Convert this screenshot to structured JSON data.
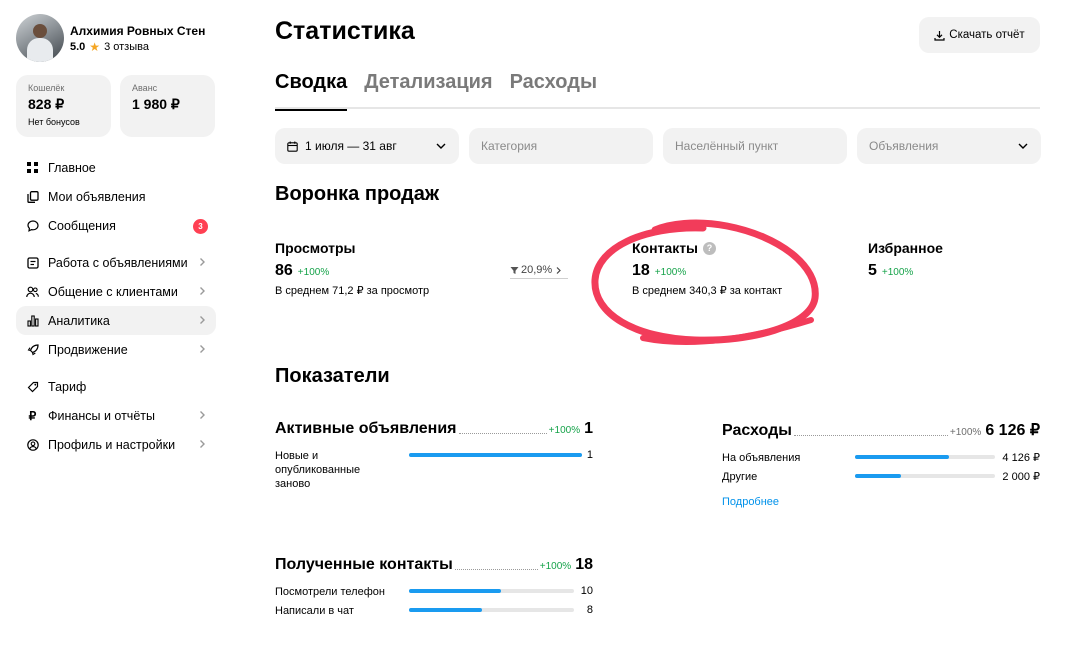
{
  "profile": {
    "name": "Алхимия Ровных Стен",
    "rating": "5.0",
    "reviews": "3 отзыва"
  },
  "wallet": {
    "label": "Кошелёк",
    "amount": "828 ₽",
    "bonus": "Нет бонусов"
  },
  "advance": {
    "label": "Аванс",
    "amount": "1 980 ₽"
  },
  "nav": {
    "home": "Главное",
    "my_ads": "Мои объявления",
    "messages": "Сообщения",
    "messages_badge": "3",
    "ads_work": "Работа с объявлениями",
    "clients": "Общение с клиентами",
    "analytics": "Аналитика",
    "promotion": "Продвижение",
    "tariff": "Тариф",
    "finance": "Финансы и отчёты",
    "profile_settings": "Профиль и настройки"
  },
  "header": {
    "title": "Статистика",
    "download": "Скачать отчёт"
  },
  "tabs": [
    "Сводка",
    "Детализация",
    "Расходы"
  ],
  "filters": {
    "period": "1 июля — 31 авг",
    "category": "Категория",
    "city": "Населённый пункт",
    "ads": "Объявления"
  },
  "funnel": {
    "title": "Воронка продаж",
    "views": {
      "title": "Просмотры",
      "value": "86",
      "pct": "+100%",
      "avg": "В среднем 71,2 ₽ за просмотр"
    },
    "conversion": "20,9%",
    "contacts": {
      "title": "Контакты",
      "value": "18",
      "pct": "+100%",
      "avg": "В среднем 340,3 ₽ за контакт",
      "help": "?"
    },
    "favorites": {
      "title": "Избранное",
      "value": "5",
      "pct": "+100%"
    }
  },
  "indicators": {
    "title": "Показатели",
    "active_ads": {
      "title": "Активные объявления",
      "pct": "+100%",
      "value": "1",
      "rows": [
        {
          "label": "Новые и опубликованные заново",
          "value": "1",
          "fill": 1.0
        }
      ]
    },
    "expenses": {
      "title": "Расходы",
      "pct": "+100%",
      "value": "6 126 ₽",
      "rows": [
        {
          "label": "На объявления",
          "value": "4 126 ₽",
          "fill": 0.67
        },
        {
          "label": "Другие",
          "value": "2 000 ₽",
          "fill": 0.33
        }
      ],
      "more": "Подробнее"
    },
    "contacts": {
      "title": "Полученные контакты",
      "pct": "+100%",
      "value": "18",
      "rows": [
        {
          "label": "Посмотрели телефон",
          "value": "10",
          "fill": 0.56
        },
        {
          "label": "Написали в чат",
          "value": "8",
          "fill": 0.44
        }
      ]
    }
  },
  "colors": {
    "accent_blue": "#1a9bf0",
    "positive_green": "#16a34a",
    "badge_red": "#ff4053",
    "annotation_red": "#f23c5a",
    "link_blue": "#0091ea",
    "surface_gray": "#f2f2f2"
  }
}
